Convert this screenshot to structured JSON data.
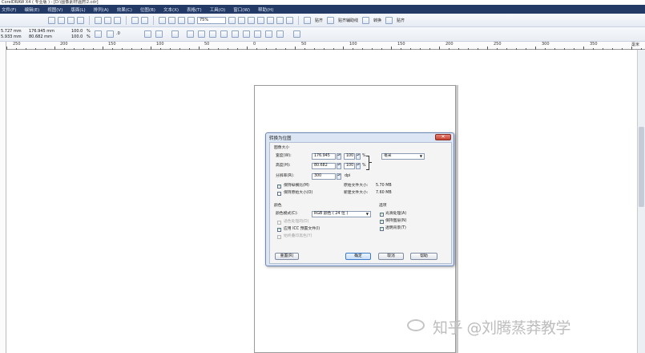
{
  "window": {
    "title": "CorelDRAW X4 ( 专业版 ) - [D:\\图像素材\\图形2.cdr]"
  },
  "menu": [
    "文件(F)",
    "编辑(E)",
    "视图(V)",
    "版面(L)",
    "排列(A)",
    "效果(C)",
    "位图(B)",
    "文本(X)",
    "表格(T)",
    "工具(O)",
    "窗口(W)",
    "帮助(H)"
  ],
  "toolbar": {
    "zoom": "75%",
    "labels": [
      "贴齐",
      "贴齐辅助线",
      "转换",
      "贴齐"
    ]
  },
  "propbar": {
    "x": "5.727 mm",
    "y": "5.933 mm",
    "width": "176.945 mm",
    "height": "80.682 mm",
    "scale_w": "100.0",
    "scale_h": "100.0",
    "percent": "%",
    "angle": ".0"
  },
  "ruler": {
    "labels": [
      "250",
      "200",
      "150",
      "100",
      "50",
      "0",
      "50",
      "100",
      "150",
      "200",
      "250",
      "300",
      "350",
      "毫米"
    ]
  },
  "dialog": {
    "title": "转换为位图",
    "close": "✕",
    "size_section": "图像大小",
    "width_label": "宽度(W):",
    "width_value": "176.945",
    "width_pct": "100",
    "height_label": "高度(H):",
    "height_value": "80.682",
    "height_pct": "100",
    "pct_unit": "%",
    "unit": "毫米",
    "resolution_label": "分辨率(R):",
    "resolution_value": "300",
    "resolution_unit": "dpi",
    "keep_ratio": "保持纵横比(M)",
    "keep_size": "保持原始大小(O)",
    "orig_size_label": "原始文件大小:",
    "orig_size_value": "5.70 MB",
    "new_size_label": "新建文件大小:",
    "new_size_value": "7.60 MB",
    "color_section": "颜色",
    "color_mode_label": "颜色模式(C):",
    "color_mode_value": "RGB 颜色 ( 24 位 )",
    "dither": "递色处理的(D)",
    "icc": "应用 ICC 预置文件(I)",
    "always_overprint": "始终叠印黑色(Y)",
    "options_section": "选项",
    "antialias": "光滑处理(A)",
    "transparent_bg": "透明背景(T)",
    "keep_layers": "保持图层(N)",
    "reset": "重置(R)",
    "ok": "确定",
    "cancel": "取消",
    "help": "帮助"
  },
  "watermark": "知乎 @刘腾蒸莽教学"
}
